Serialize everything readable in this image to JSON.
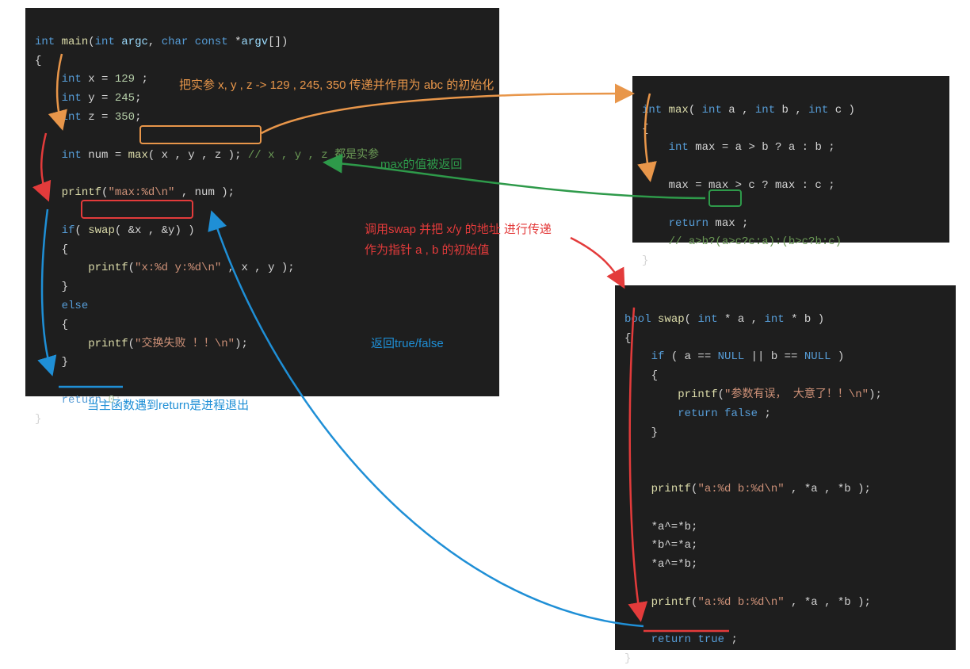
{
  "main_block": {
    "sig": {
      "ret": "int",
      "name": "main",
      "params": "int argc, char const *argv[]"
    },
    "vars": {
      "x_decl": "int x = 129 ;",
      "y_decl": "int y = 245;",
      "z_decl": "int z = 350;"
    },
    "call_max_lhs": "int num = ",
    "call_max_call": "max( x , y , z )",
    "call_max_comment": "// x , y , z 都是实参",
    "printf_max": "printf(\"max:%d\\n\" , num );",
    "if_swap_kw": "if( ",
    "if_swap_call": "swap( &x , &y)",
    "if_swap_close": " )",
    "printf_xy": "printf(\"x:%d y:%d\\n\" , x , y );",
    "else_kw": "else",
    "printf_fail": "printf(\"交换失败 ！！\\n\");",
    "return": "return 0;"
  },
  "max_block": {
    "sig": {
      "ret": "int",
      "name": "max",
      "params": "int a , int b , int c"
    },
    "l1": "int max = a > b ? a : b ;",
    "l2": "max = max > c ? max : c ;",
    "ret": "return max ;",
    "comment": "// a>b?(a>c?c:a):(b>c?b:c)"
  },
  "swap_block": {
    "sig": {
      "ret": "bool",
      "name": "swap",
      "params": "int * a , int * b"
    },
    "if_cond": "if ( a == NULL || b == NULL )",
    "printf_err": "printf(\"参数有误， 大意了！！\\n\");",
    "ret_false": "return false ;",
    "printf1": "printf(\"a:%d b:%d\\n\" , *a , *b );",
    "xor1": "*a^=*b;",
    "xor2": "*b^=*a;",
    "xor3": "*a^=*b;",
    "printf2": "printf(\"a:%d b:%d\\n\" , *a , *b );",
    "ret_true": "return true ;"
  },
  "annotations": {
    "orange": "把实参 x, y , z -> 129 , 245, 350 传递并作用为 abc 的初始化",
    "green": "max的值被返回",
    "red1": "调用swap 并把 x/y 的地址 进行传递",
    "red2": "作为指针 a , b 的初始值",
    "blue1": "返回true/false",
    "blue2": "当主函数遇到return是进程退出"
  },
  "colors": {
    "orange": "#e8964a",
    "green": "#2e9a4a",
    "red": "#e33b3b",
    "blue": "#1f8fd6"
  }
}
